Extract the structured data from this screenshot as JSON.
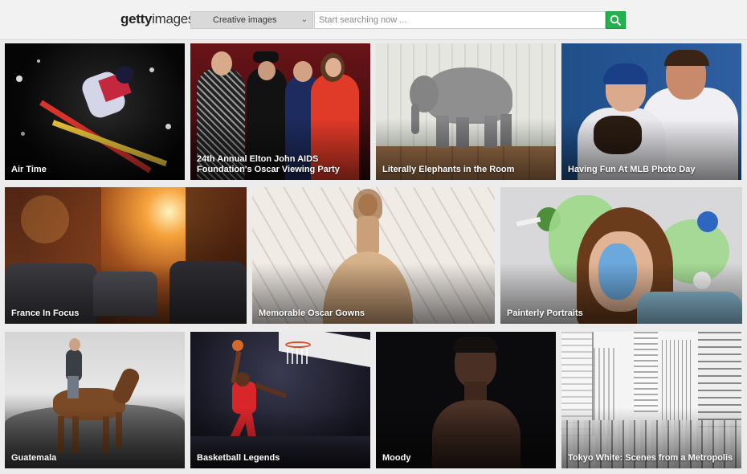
{
  "header": {
    "logo_bold": "getty",
    "logo_light": "images",
    "category_select": "Creative images",
    "search_placeholder": "Start searching now ...",
    "search_icon": "search-icon",
    "accent_color": "#22b14c"
  },
  "tiles": [
    {
      "caption": "Air Time"
    },
    {
      "caption": "24th Annual Elton John AIDS Foundation's Oscar Viewing Party"
    },
    {
      "caption": "Literally Elephants in the Room"
    },
    {
      "caption": "Having Fun At MLB Photo Day"
    },
    {
      "caption": "France In Focus"
    },
    {
      "caption": "Memorable Oscar Gowns"
    },
    {
      "caption": "Painterly Portraits"
    },
    {
      "caption": "Guatemala"
    },
    {
      "caption": "Basketball Legends"
    },
    {
      "caption": "Moody"
    },
    {
      "caption": "Tokyo White: Scenes from a Metropolis"
    }
  ]
}
